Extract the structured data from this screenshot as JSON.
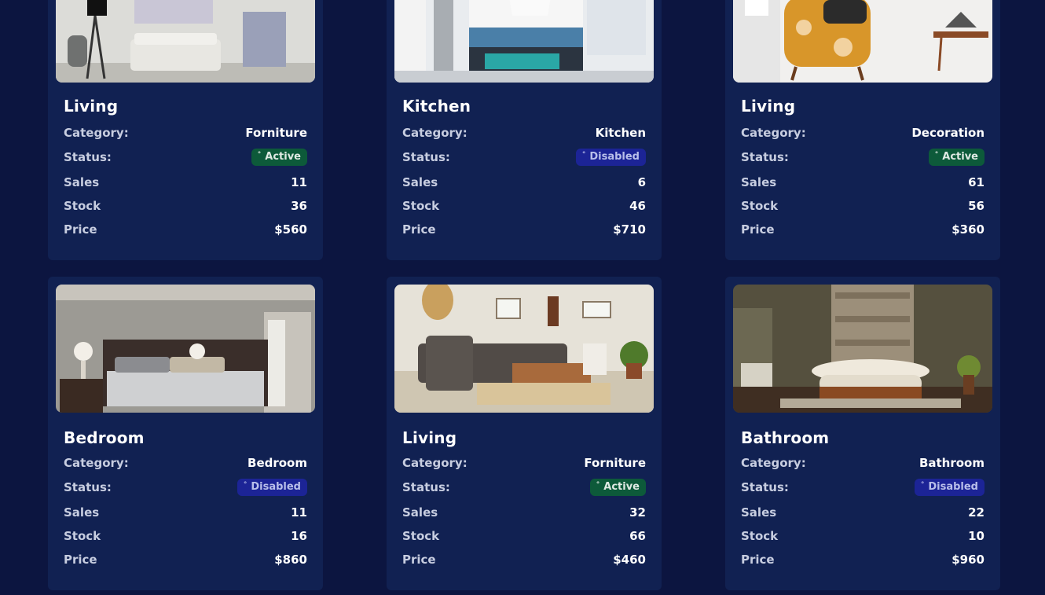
{
  "products": [
    {
      "title": "Living",
      "category_label": "Category:",
      "category": "Forniture",
      "status_label": "Status:",
      "status": "Active",
      "status_dot": "°",
      "sales_label": "Sales",
      "sales": "11",
      "stock_label": "Stock",
      "stock": "36",
      "price_label": "Price",
      "price": "$560",
      "image": "living-room-photo"
    },
    {
      "title": "Kitchen",
      "category_label": "Category:",
      "category": "Kitchen",
      "status_label": "Status:",
      "status": "Disabled",
      "status_dot": "°",
      "sales_label": "Sales",
      "sales": "6",
      "stock_label": "Stock",
      "stock": "46",
      "price_label": "Price",
      "price": "$710",
      "image": "kitchen-photo"
    },
    {
      "title": "Living",
      "category_label": "Category:",
      "category": "Decoration",
      "status_label": "Status:",
      "status": "Active",
      "status_dot": "°",
      "sales_label": "Sales",
      "sales": "61",
      "stock_label": "Stock",
      "stock": "56",
      "price_label": "Price",
      "price": "$360",
      "image": "armchair-photo"
    },
    {
      "title": "Bedroom",
      "category_label": "Category:",
      "category": "Bedroom",
      "status_label": "Status:",
      "status": "Disabled",
      "status_dot": "°",
      "sales_label": "Sales",
      "sales": "11",
      "stock_label": "Stock",
      "stock": "16",
      "price_label": "Price",
      "price": "$860",
      "image": "bedroom-photo"
    },
    {
      "title": "Living",
      "category_label": "Category:",
      "category": "Forniture",
      "status_label": "Status:",
      "status": "Active",
      "status_dot": "°",
      "sales_label": "Sales",
      "sales": "32",
      "stock_label": "Stock",
      "stock": "66",
      "price_label": "Price",
      "price": "$460",
      "image": "living-room-sofa-photo"
    },
    {
      "title": "Bathroom",
      "category_label": "Category:",
      "category": "Bathroom",
      "status_label": "Status:",
      "status": "Disabled",
      "status_dot": "°",
      "sales_label": "Sales",
      "sales": "22",
      "stock_label": "Stock",
      "stock": "10",
      "price_label": "Price",
      "price": "$960",
      "image": "bathroom-photo"
    }
  ],
  "colors": {
    "page_bg": "#0c1540",
    "card_bg": "#112152",
    "active_badge_bg": "#0d5a3a",
    "disabled_badge_bg": "#1c2496"
  }
}
